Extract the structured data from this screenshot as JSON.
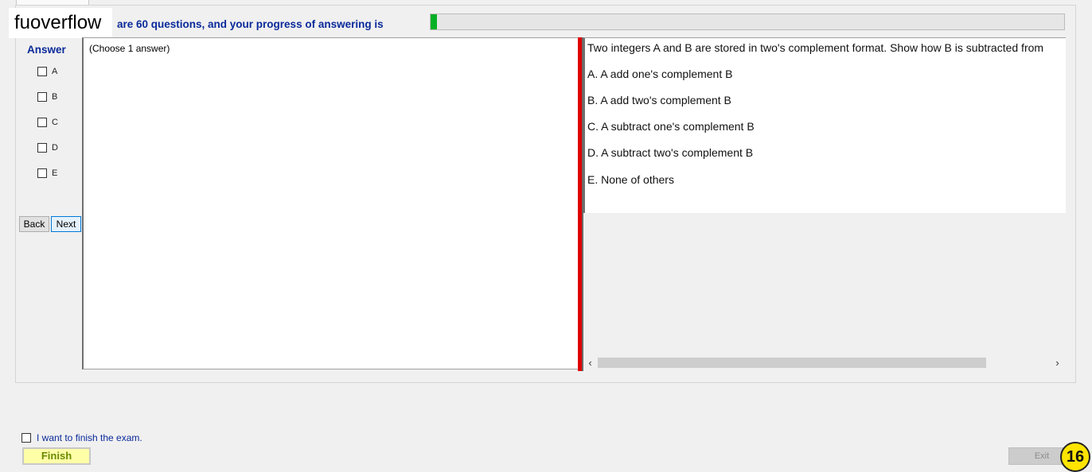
{
  "header": {
    "brand": "fuoverflow",
    "progress_label": "are 60 questions, and your progress of answering is",
    "progress_fraction": 0.01
  },
  "answer_panel": {
    "title": "Answer",
    "options": [
      "A",
      "B",
      "C",
      "D",
      "E"
    ],
    "back_label": "Back",
    "next_label": "Next"
  },
  "left_panel": {
    "note": "(Choose 1 answer)"
  },
  "question": {
    "text": "Two integers A and B are stored in two's complement format. Show how B is subtracted from",
    "options": [
      "A.  A add one's complement B",
      "B.  A add two's complement B",
      "C.  A subtract one's complement B",
      "D.  A subtract two's complement B",
      "E.  None of others"
    ]
  },
  "footer": {
    "finish_checkbox_label": "I want to finish the exam.",
    "finish_button": "Finish",
    "exit_button": "Exit",
    "badge_number": "16"
  },
  "colors": {
    "label_blue": "#0a2a9a",
    "progress_green": "#06b025",
    "splitter_red": "#e00000",
    "badge_yellow": "#ffe400"
  }
}
